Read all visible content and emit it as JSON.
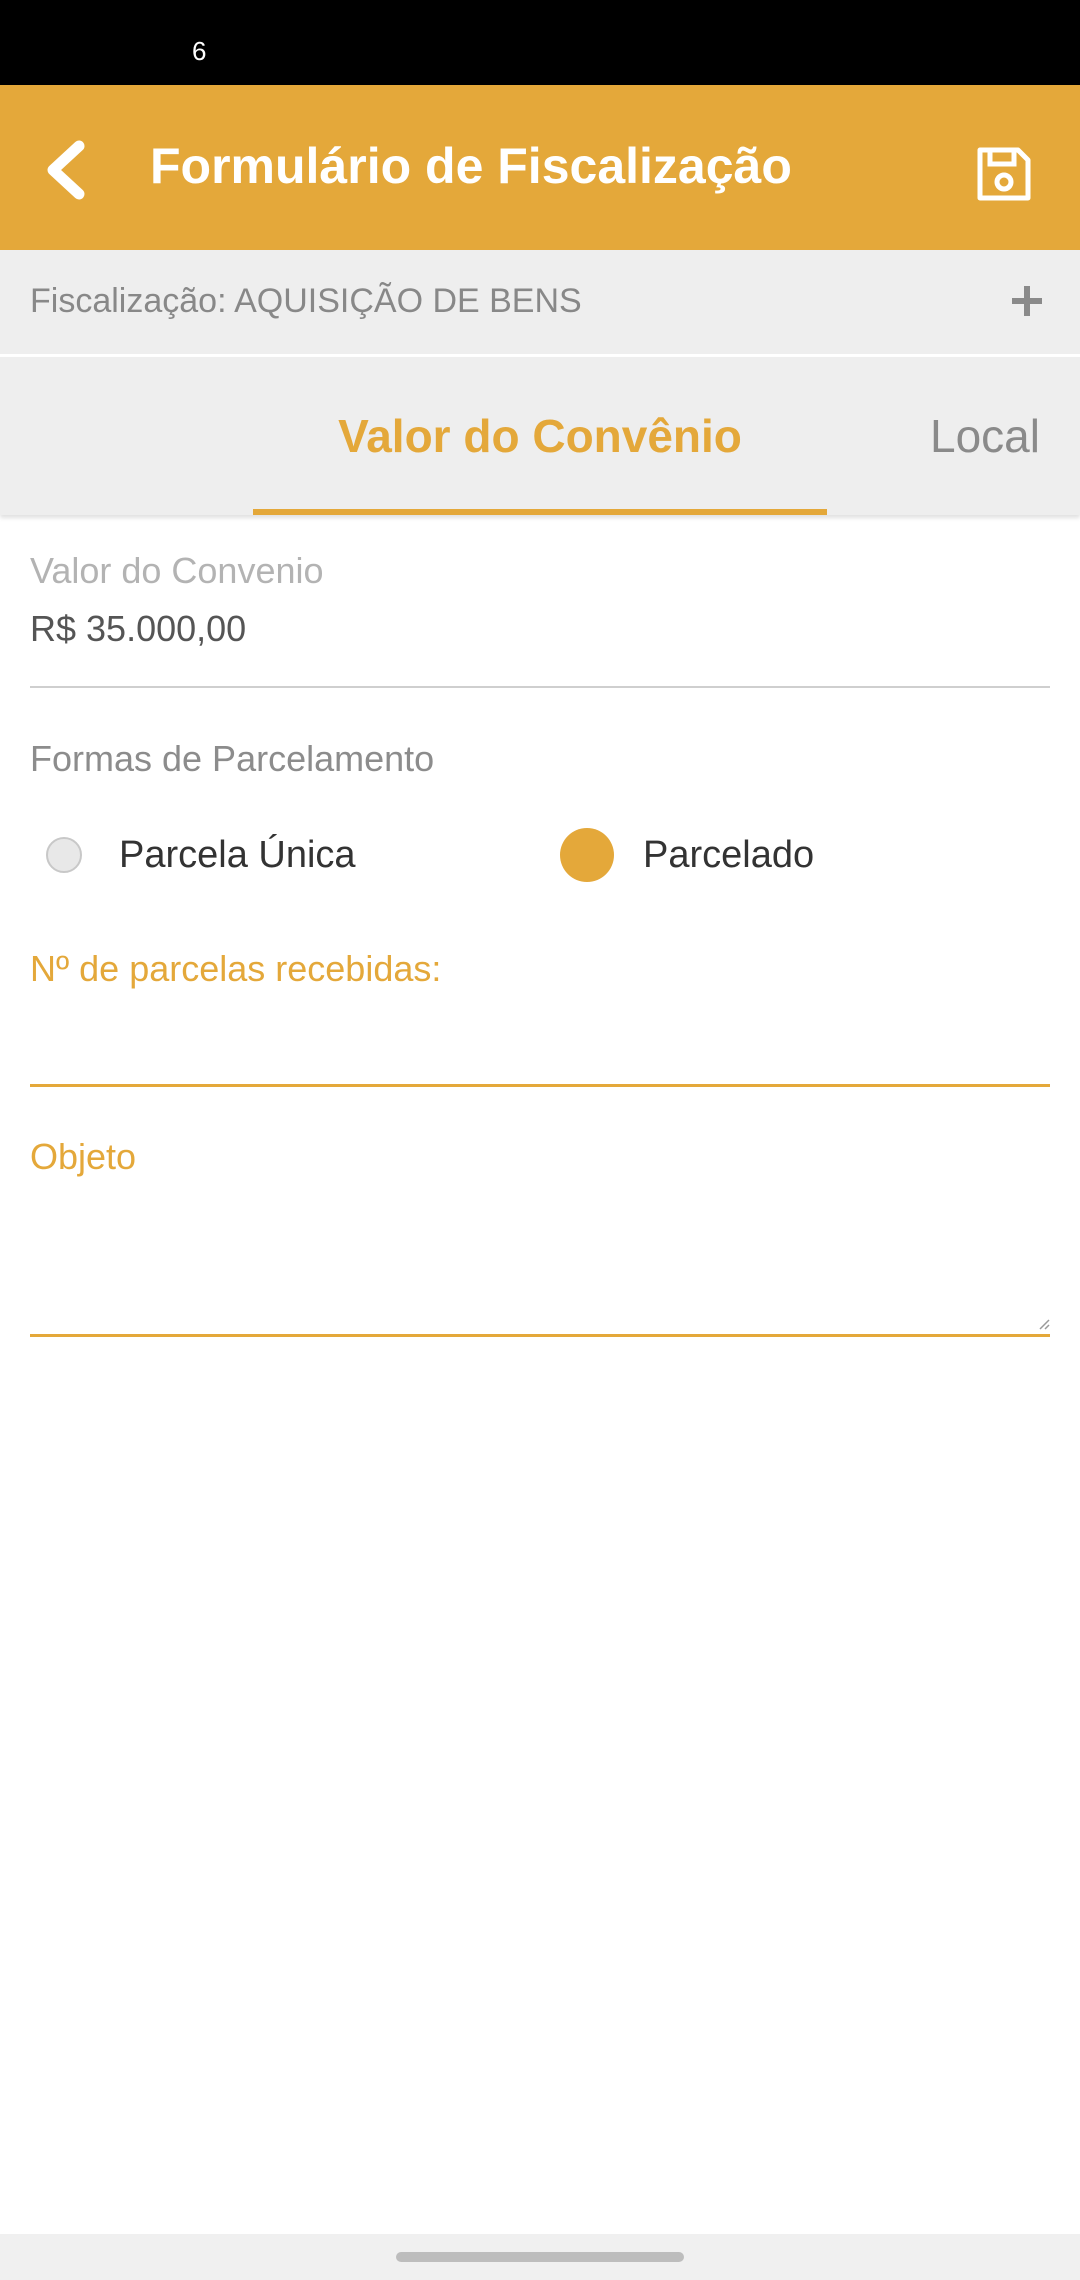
{
  "status_bar": {
    "time": "6"
  },
  "app_bar": {
    "title": "Formulário de Fiscalização",
    "back_icon": "chevron-left-icon",
    "save_icon": "floppy-disk-icon",
    "color": "#e4a83a"
  },
  "subheader": {
    "label": "Fiscalização: AQUISIÇÃO DE BENS",
    "action_icon": "plus-icon"
  },
  "tabs": [
    {
      "label": "Valor do Convênio",
      "active": true
    },
    {
      "label": "Local",
      "active": false
    }
  ],
  "form": {
    "valor": {
      "label": "Valor do Convenio",
      "value": "R$ 35.000,00"
    },
    "parcelamento": {
      "label": "Formas de Parcelamento",
      "options": [
        {
          "label": "Parcela Única",
          "selected": false
        },
        {
          "label": "Parcelado",
          "selected": true
        }
      ]
    },
    "parcelas": {
      "label": "Nº de parcelas recebidas:",
      "value": ""
    },
    "objeto": {
      "label": "Objeto",
      "value": ""
    }
  }
}
